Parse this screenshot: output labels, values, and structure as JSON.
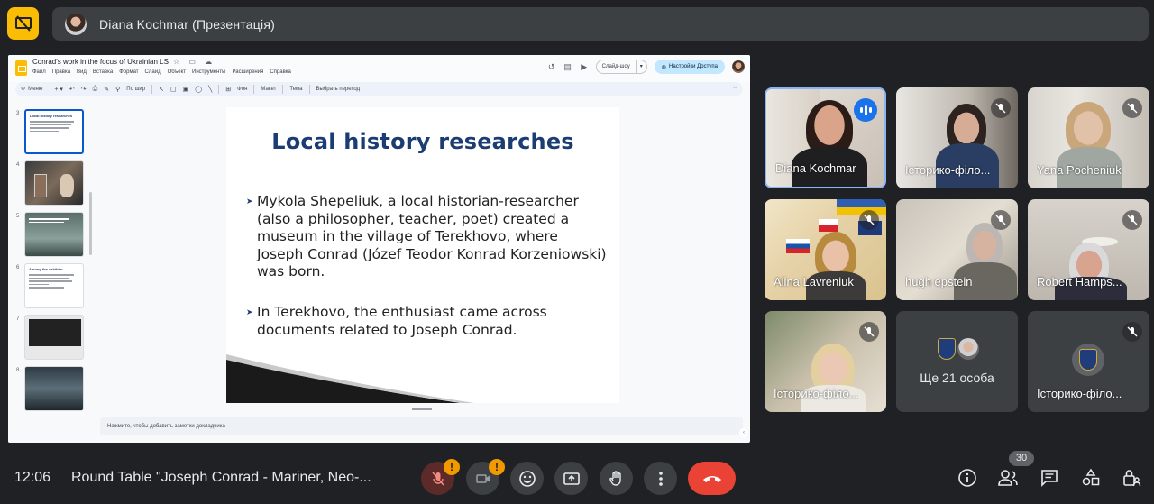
{
  "presenter_bar": {
    "text": "Diana Kochmar (Презентація)"
  },
  "slides_app": {
    "doc_title": "Conrad's work in the focus of Ukrainian LS",
    "menus": [
      "Файл",
      "Правка",
      "Вид",
      "Вставка",
      "Формат",
      "Слайд",
      "Объект",
      "Инструменты",
      "Расширения",
      "Справка"
    ],
    "slideshow_label": "Слайд-шоу",
    "share_label": "Настройки Доступа",
    "toolbar": {
      "search_label": "Меню",
      "zoom_label": "По шир",
      "bg_label": "Фон",
      "layout_label": "Макет",
      "theme_label": "Тема",
      "transition_label": "Выбрать переход"
    },
    "notes_placeholder": "Нажмите, чтобы добавить заметки докладчика",
    "thumbnails": [
      {
        "num": "3",
        "title": "Local history researches"
      },
      {
        "num": "4",
        "title": ""
      },
      {
        "num": "5",
        "title": ""
      },
      {
        "num": "6",
        "title": "Among the exhibits:"
      },
      {
        "num": "7",
        "title": ""
      },
      {
        "num": "8",
        "title": ""
      }
    ],
    "slide": {
      "title": "Local history researches",
      "bullets": [
        "Mykola Shepeliuk, a local historian-researcher (also a philosopher, teacher, poet) created a museum in the village of Terekhovo, where Joseph Conrad (Józef Teodor Konrad Korzeniowski) was born.",
        "In Terekhovo, the enthusiast came across documents related to Joseph Conrad."
      ]
    }
  },
  "participants": [
    {
      "name": "Diana Kochmar",
      "speaking": true
    },
    {
      "name": "Історико-філо...",
      "muted": true
    },
    {
      "name": "Yana Pocheniuk",
      "muted": true
    },
    {
      "name": "Alina Lavreniuk",
      "muted": true
    },
    {
      "name": "hugh epstein",
      "muted": true
    },
    {
      "name": "Robert Hamps...",
      "muted": true
    },
    {
      "name": "Історико-філо...",
      "muted": true
    },
    {
      "name": "Ще 21 особа"
    },
    {
      "name": "Історико-філо...",
      "muted": true
    }
  ],
  "bottom_bar": {
    "time": "12:06",
    "meeting_title": "Round Table \"Joseph Conrad - Mariner, Neo-...",
    "people_count": "30",
    "alert_glyph": "!"
  },
  "colors": {
    "accent_blue": "#8ab4f8",
    "end_call_red": "#ea4335",
    "present_yellow": "#fbbc04",
    "slide_title_navy": "#1c3d73"
  }
}
